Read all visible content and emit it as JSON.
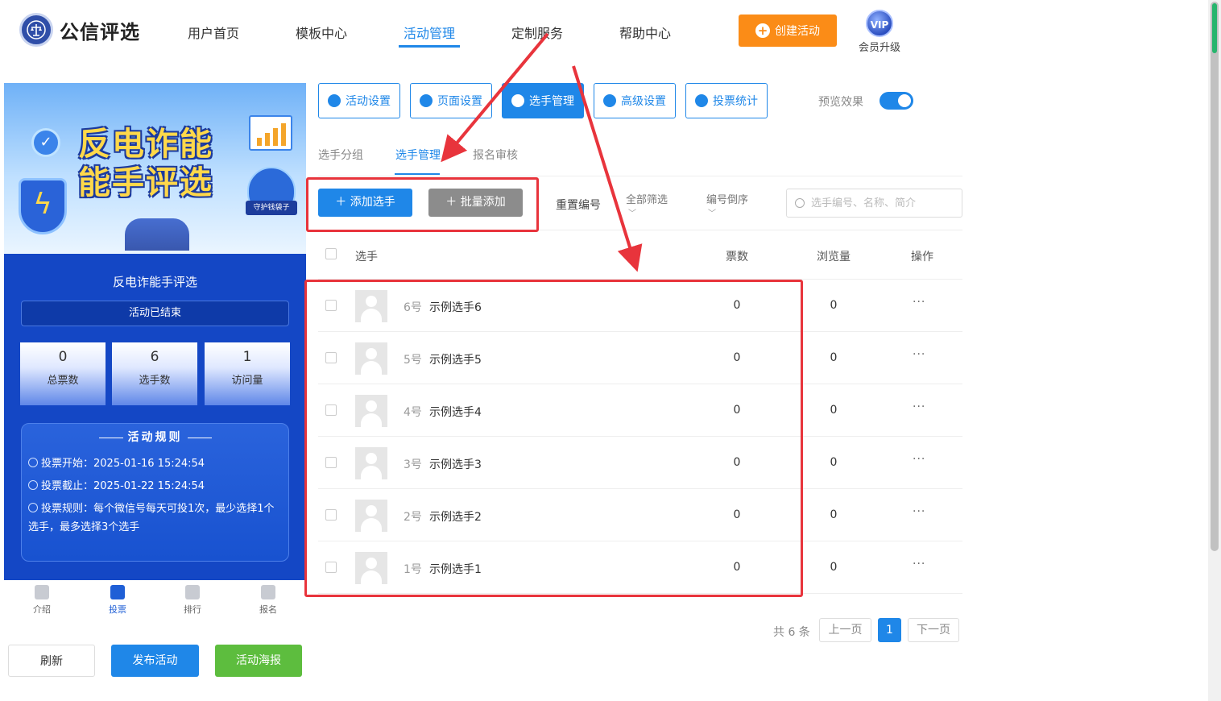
{
  "brand": {
    "name": "公信评选"
  },
  "nav": {
    "items": [
      "用户首页",
      "模板中心",
      "活动管理",
      "定制服务",
      "帮助中心"
    ],
    "create_label": "创建活动",
    "vip_badge": "VIP",
    "vip_label": "会员升级"
  },
  "preview": {
    "banner_title_line1": "反电诈能",
    "banner_title_line2": "能手评选",
    "banner_tag": "守护钱袋子",
    "title": "反电诈能手评选",
    "status": "活动已结束",
    "stats": [
      {
        "value": "0",
        "label": "总票数"
      },
      {
        "value": "6",
        "label": "选手数"
      },
      {
        "value": "1",
        "label": "访问量"
      }
    ],
    "rules_title": "活动规则",
    "rules": [
      "投票开始：2025-01-16 15:24:54",
      "投票截止：2025-01-22 15:24:54",
      "投票规则：每个微信号每天可投1次，最少选择1个选手，最多选择3个选手"
    ],
    "tabs": [
      "介绍",
      "投票",
      "排行",
      "报名"
    ],
    "buttons": {
      "refresh": "刷新",
      "publish": "发布活动",
      "poster": "活动海报"
    }
  },
  "toolbar": {
    "buttons": [
      "活动设置",
      "页面设置",
      "选手管理",
      "高级设置",
      "投票统计"
    ],
    "preview_label": "预览效果"
  },
  "subtabs": [
    "选手分组",
    "选手管理",
    "报名审核"
  ],
  "actions": {
    "add": "添加选手",
    "batch_add": "批量添加",
    "reset_number": "重置编号",
    "filter_all": "全部筛选",
    "sort_desc": "编号倒序",
    "search_placeholder": "选手编号、名称、简介"
  },
  "table": {
    "headers": {
      "player": "选手",
      "votes": "票数",
      "views": "浏览量",
      "ops": "操作"
    },
    "rows": [
      {
        "no": "6号",
        "name": "示例选手6",
        "votes": "0",
        "views": "0",
        "more": "···"
      },
      {
        "no": "5号",
        "name": "示例选手5",
        "votes": "0",
        "views": "0",
        "more": "···"
      },
      {
        "no": "4号",
        "name": "示例选手4",
        "votes": "0",
        "views": "0",
        "more": "···"
      },
      {
        "no": "3号",
        "name": "示例选手3",
        "votes": "0",
        "views": "0",
        "more": "···"
      },
      {
        "no": "2号",
        "name": "示例选手2",
        "votes": "0",
        "views": "0",
        "more": "···"
      },
      {
        "no": "1号",
        "name": "示例选手1",
        "votes": "0",
        "views": "0",
        "more": "···"
      }
    ]
  },
  "pagination": {
    "total": "共 6 条",
    "prev": "上一页",
    "current": "1",
    "next": "下一页"
  },
  "colors": {
    "primary": "#1f87e8",
    "orange": "#fb8c17",
    "green": "#5dbd3e",
    "annotation_red": "#e8343c"
  },
  "icons": [
    "emblem-icon",
    "plus-icon",
    "vip-icon",
    "gear-icon",
    "users-icon",
    "settings-icon",
    "bar-chart-icon",
    "search-icon",
    "clock-icon",
    "info-icon"
  ]
}
